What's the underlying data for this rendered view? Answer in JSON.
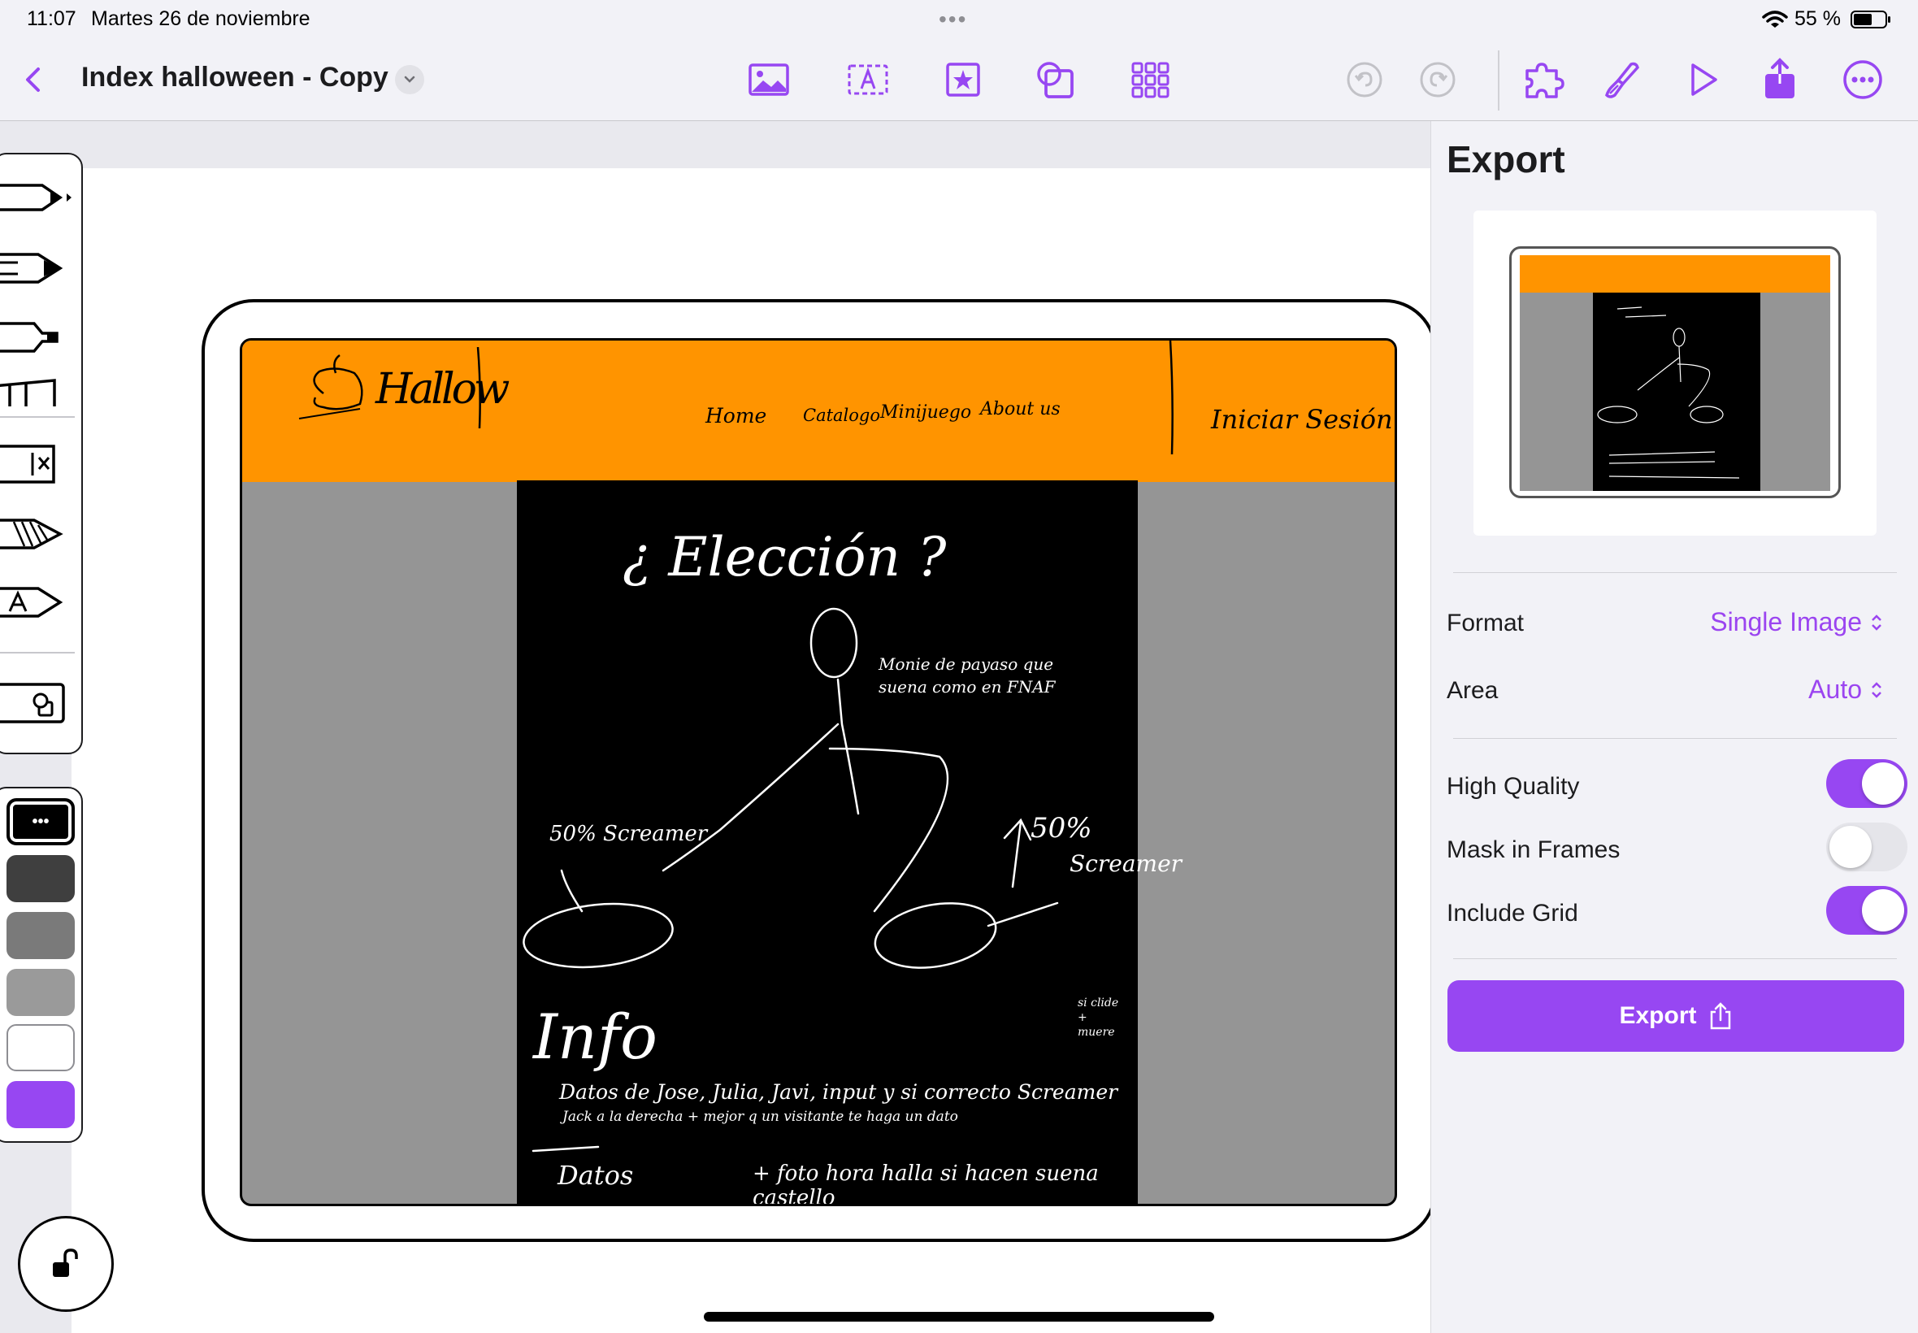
{
  "status_bar": {
    "time": "11:07",
    "date": "Martes 26 de noviembre",
    "dots": "•••",
    "battery": "55 %"
  },
  "toolbar": {
    "back_icon": "chevron-left-icon",
    "title": "Index halloween - Copy",
    "tools": [
      "image-icon",
      "text-box-icon",
      "stamp-icon",
      "shapes-icon",
      "grid-icon"
    ],
    "history": [
      "undo-icon",
      "redo-icon"
    ],
    "actions": [
      "puzzle-icon",
      "brush-icon",
      "play-icon",
      "share-icon",
      "more-icon"
    ]
  },
  "mockup": {
    "logo_text": "Hallow",
    "nav": [
      "Home",
      "Catalogo",
      "Minijuego",
      "About us"
    ],
    "login": "Iniciar Sesión",
    "question": "¿ Elección ?",
    "note": "Monie de payaso que suena como en FNAF",
    "pct_left": "50% Screamer",
    "pct_right": "50%",
    "screamer": "Screamer",
    "info_title": "Info",
    "info_line1": "Datos de Jose, Julia, Javi, input y si correcto Screamer",
    "info_line2": "Jack a la derecha + mejor q un visitante te haga un dato",
    "datos": "Datos",
    "foto": "+ foto hora halla si hacen suena castello",
    "side_note": "si clide + muere"
  },
  "tool_palette": {
    "tools": [
      "pen-icon",
      "marker-icon",
      "highlighter-icon",
      "ruler-icon",
      "eraser-icon",
      "pencil-shading-icon",
      "text-pen-icon",
      "lasso-shape-icon"
    ]
  },
  "colors": {
    "swatches": [
      "#000000",
      "#3f3f3f",
      "#7a7a7a",
      "#9a9a9a",
      "#ffffff",
      "#9747f2"
    ],
    "accent": "#9747f2",
    "header_orange": "#ff9400"
  },
  "export_panel": {
    "title": "Export",
    "format_label": "Format",
    "format_value": "Single Image",
    "area_label": "Area",
    "area_value": "Auto",
    "toggles": [
      {
        "label": "High Quality",
        "on": true
      },
      {
        "label": "Mask in Frames",
        "on": false
      },
      {
        "label": "Include Grid",
        "on": true
      }
    ],
    "export_button": "Export"
  }
}
